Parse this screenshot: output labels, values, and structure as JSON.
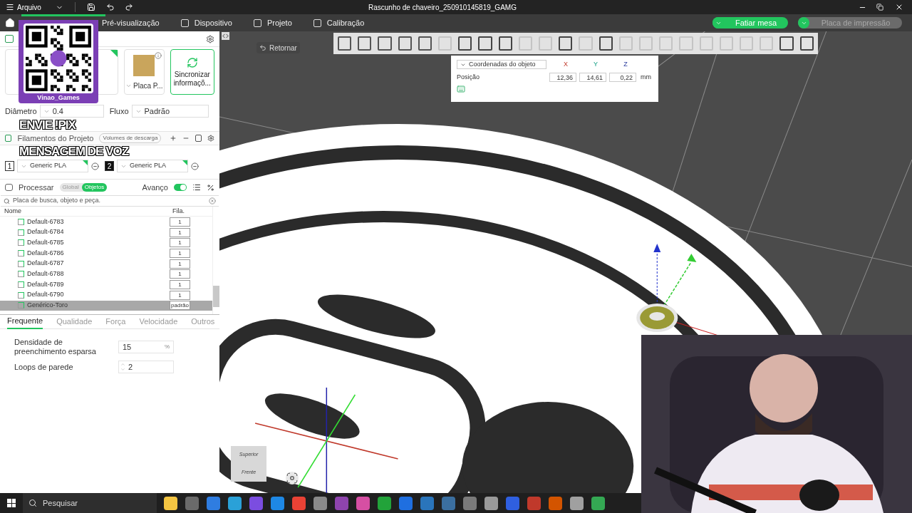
{
  "window": {
    "title": "Rascunho de chaveiro_250910145819_GAMG"
  },
  "menu": {
    "label": "Arquivo"
  },
  "tabs": [
    {
      "label": "Pré-visualização",
      "selected": false
    },
    {
      "label": "Dispositivo",
      "selected": false
    },
    {
      "label": "Projeto",
      "selected": false
    },
    {
      "label": "Calibração",
      "selected": false
    }
  ],
  "actions": [
    {
      "label": "Fatiar mesa",
      "disabled": false
    },
    {
      "label": "Placa de impressão",
      "disabled": true
    }
  ],
  "printer": {
    "plate": "Placa P...",
    "sync": "Sincronizar informaçõ..."
  },
  "nozzle": {
    "diameter_label": "Diâmetro",
    "diameter": "0.4",
    "flow_label": "Fluxo",
    "flow": "Padrão"
  },
  "filaments": {
    "title": "Filamentos do Projeto",
    "flush": "Volumes de descarga",
    "items": [
      {
        "index": "1",
        "name": "Generic PLA",
        "color": "#ffffff"
      },
      {
        "index": "2",
        "name": "Generic PLA",
        "color": "#111111"
      }
    ]
  },
  "process": {
    "title": "Processar",
    "modes": [
      {
        "label": "Global",
        "selected": false
      },
      {
        "label": "Objetos",
        "selected": true
      }
    ],
    "advanced_label": "Avanço",
    "advanced": true,
    "search_placeholder": "Placa de busca, objeto e peça."
  },
  "objects": {
    "columns": [
      "Nome",
      "Fila."
    ],
    "rows": [
      {
        "name": "Default-6783",
        "filament": "1",
        "selected": false
      },
      {
        "name": "Default-6784",
        "filament": "1",
        "selected": false
      },
      {
        "name": "Default-6785",
        "filament": "1",
        "selected": false
      },
      {
        "name": "Default-6786",
        "filament": "1",
        "selected": false
      },
      {
        "name": "Default-6787",
        "filament": "1",
        "selected": false
      },
      {
        "name": "Default-6788",
        "filament": "1",
        "selected": false
      },
      {
        "name": "Default-6789",
        "filament": "1",
        "selected": false
      },
      {
        "name": "Default-6790",
        "filament": "1",
        "selected": false
      },
      {
        "name": "Genérico-Toro",
        "filament": "padrão",
        "selected": true
      }
    ]
  },
  "settings_tabs": [
    {
      "label": "Frequente",
      "selected": true
    },
    {
      "label": "Qualidade",
      "selected": false
    },
    {
      "label": "Força",
      "selected": false
    },
    {
      "label": "Velocidade",
      "selected": false
    },
    {
      "label": "Outros",
      "selected": false
    }
  ],
  "settings": [
    {
      "kind": "unit",
      "label": "Densidade de preenchimento esparsa",
      "value": "15",
      "unit": "%"
    },
    {
      "kind": "spin",
      "label": "Loops de parede",
      "value": "2"
    }
  ],
  "viewport": {
    "back": "Retornar",
    "coords": {
      "mode": "Coordenadas do objeto",
      "axes": [
        "X",
        "Y",
        "Z"
      ],
      "row_label": "Posição",
      "values": [
        "12,36",
        "14,61",
        "0,22"
      ],
      "unit": "mm"
    },
    "cube": [
      "Superior",
      "Frente"
    ]
  },
  "overlay": {
    "channel": "Vinao_Games",
    "lines": [
      "ENVIE !PIX",
      "MENSAGEM DE VOZ"
    ]
  },
  "taskbar": {
    "search": "Pesquisar"
  }
}
